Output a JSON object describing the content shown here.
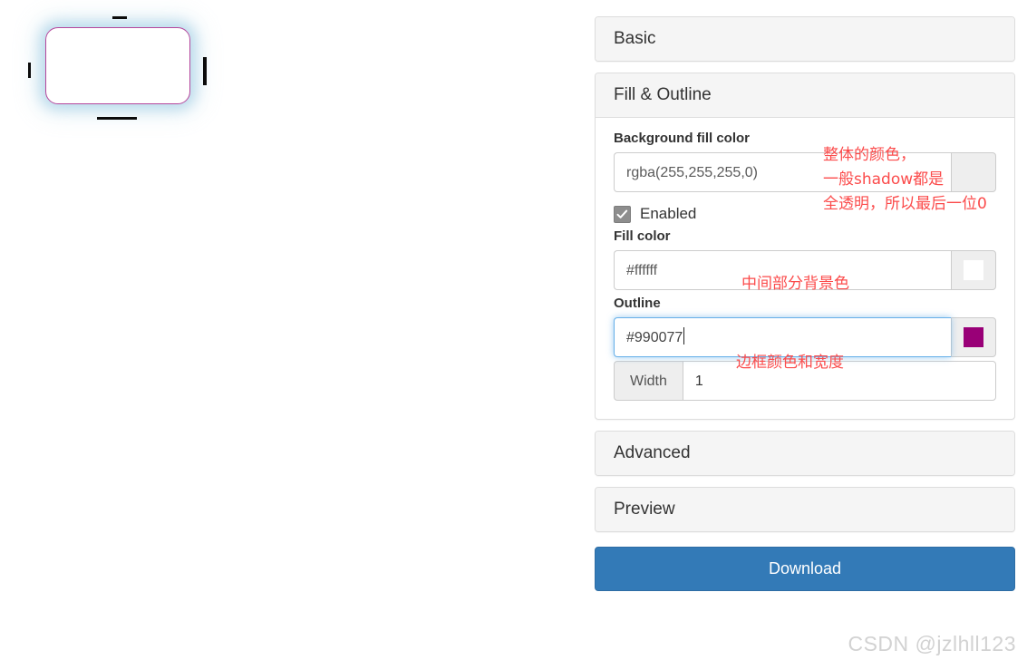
{
  "preview": {
    "shape_name": "rounded-rectangle-preview",
    "fill_color": "#ffffff",
    "outline_color": "#990077",
    "glow_color": "#a9cfe0"
  },
  "panels": [
    {
      "id": "basic",
      "title": "Basic",
      "expanded": false
    },
    {
      "id": "fill-outline",
      "title": "Fill & Outline",
      "expanded": true
    },
    {
      "id": "advanced",
      "title": "Advanced",
      "expanded": false
    },
    {
      "id": "preview",
      "title": "Preview",
      "expanded": false
    }
  ],
  "fill_outline": {
    "background_fill_label": "Background fill color",
    "background_fill_value": "rgba(255,255,255,0)",
    "background_fill_swatch": "transparent",
    "enabled_label": "Enabled",
    "enabled_checked": true,
    "fill_color_label": "Fill color",
    "fill_color_value": "#ffffff",
    "fill_color_swatch": "#ffffff",
    "outline_label": "Outline",
    "outline_value": "#990077",
    "outline_swatch": "#990077",
    "outline_focused": true,
    "width_label": "Width",
    "width_value": "1"
  },
  "actions": {
    "download_label": "Download"
  },
  "annotations": [
    {
      "id": "bg-fill",
      "text": "整体的颜色，\n一般shadow都是\n全透明，所以最后一位0"
    },
    {
      "id": "fill",
      "text": "中间部分背景色"
    },
    {
      "id": "outline",
      "text": "边框颜色和宽度"
    }
  ],
  "watermark": {
    "text": "CSDN @jzlhll123"
  },
  "colors": {
    "accent_button": "#337ab7",
    "annotation_red": "#fb4b4b",
    "focus_blue": "#66afe9",
    "outline_purple": "#990077"
  }
}
